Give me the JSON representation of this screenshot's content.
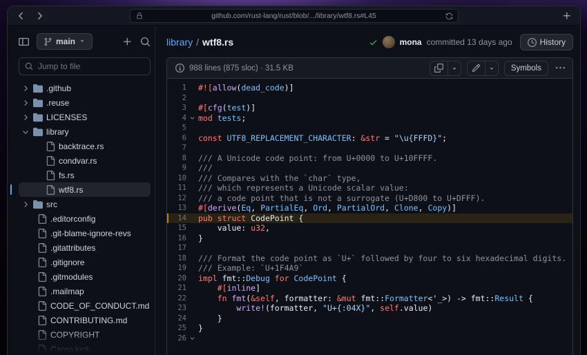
{
  "browser": {
    "url": "github.com/rust-lang/rust/blob/.../library/wtf8.rs#L45"
  },
  "sidebar": {
    "branch": "main",
    "jump_placeholder": "Jump to file",
    "tree": [
      {
        "name": ".github",
        "type": "dir",
        "expanded": false
      },
      {
        "name": ".reuse",
        "type": "dir",
        "expanded": false
      },
      {
        "name": "LICENSES",
        "type": "dir",
        "expanded": false
      },
      {
        "name": "library",
        "type": "dir",
        "expanded": true
      },
      {
        "name": "backtrace.rs",
        "type": "file",
        "depth": 1
      },
      {
        "name": "condvar.rs",
        "type": "file",
        "depth": 1
      },
      {
        "name": "fs.rs",
        "type": "file",
        "depth": 1
      },
      {
        "name": "wtf8.rs",
        "type": "file",
        "depth": 1,
        "selected": true
      },
      {
        "name": "src",
        "type": "dir",
        "expanded": false
      },
      {
        "name": ".editorconfig",
        "type": "file",
        "depth": 0
      },
      {
        "name": ".git-blame-ignore-revs",
        "type": "file",
        "depth": 0
      },
      {
        "name": ".gitattributes",
        "type": "file",
        "depth": 0
      },
      {
        "name": ".gitignore",
        "type": "file",
        "depth": 0
      },
      {
        "name": ".gitmodules",
        "type": "file",
        "depth": 0
      },
      {
        "name": ".mailmap",
        "type": "file",
        "depth": 0
      },
      {
        "name": "CODE_OF_CONDUCT.md",
        "type": "file",
        "depth": 0
      },
      {
        "name": "CONTRIBUTING.md",
        "type": "file",
        "depth": 0
      },
      {
        "name": "COPYRIGHT",
        "type": "file",
        "depth": 0
      },
      {
        "name": "Cargo.lock",
        "type": "file",
        "depth": 0
      }
    ]
  },
  "header": {
    "breadcrumb_dir": "library",
    "breadcrumb_separator": "/",
    "breadcrumb_file": "wtf8.rs",
    "author": "mona",
    "commit_meta": "committed 13 days ago",
    "history_label": "History"
  },
  "file_meta": {
    "summary": "988 lines (875 sloc) · 31.5 KB",
    "symbols_label": "Symbols"
  },
  "colors": {
    "link": "#58a6ff",
    "success": "#3fb950",
    "line_highlight_border": "#bb8009",
    "syntax": {
      "kw": "#ff7b72",
      "ty": "#79c0ff",
      "st": "#a5d6ff",
      "cm": "#8b949e",
      "fn": "#d2a8ff",
      "pl": "#e6edf3"
    }
  },
  "icons": {
    "back-icon": "chevron-left",
    "forward-icon": "chevron-right",
    "lock-icon": "padlock",
    "refresh-icon": "sync-arrows",
    "new-tab-icon": "plus",
    "sidebar-collapse-icon": "panel",
    "branch-icon": "git-branch",
    "caret-down-icon": "triangle-down",
    "add-icon": "plus",
    "search-icon": "magnifier",
    "folder-icon": "folder",
    "file-icon": "document",
    "chevron-icon": "chevron-right",
    "check-icon": "checkmark",
    "history-icon": "clock",
    "info-icon": "info-circle",
    "copy-icon": "overlapping-squares",
    "edit-icon": "pencil",
    "kebab-icon": "three-dots",
    "fold-chevron-icon": "chevron-down"
  },
  "code": {
    "highlight_line": 14,
    "fold_lines": [
      4,
      26
    ],
    "lines": [
      {
        "n": 1,
        "t": [
          [
            "kw",
            "#!["
          ],
          [
            "fn",
            "allow"
          ],
          [
            "pl",
            "("
          ],
          [
            "ty",
            "dead_code"
          ],
          [
            "pl",
            ")]"
          ]
        ]
      },
      {
        "n": 2,
        "t": []
      },
      {
        "n": 3,
        "t": [
          [
            "kw",
            "#["
          ],
          [
            "fn",
            "cfg"
          ],
          [
            "pl",
            "("
          ],
          [
            "ty",
            "test"
          ],
          [
            "pl",
            ")]"
          ]
        ]
      },
      {
        "n": 4,
        "t": [
          [
            "kw",
            "mod "
          ],
          [
            "ty",
            "tests"
          ],
          [
            "pl",
            ";"
          ]
        ]
      },
      {
        "n": 5,
        "t": []
      },
      {
        "n": 6,
        "t": [
          [
            "kw",
            "const "
          ],
          [
            "ty",
            "UTF8_REPLACEMENT_CHARACTER"
          ],
          [
            "pl",
            ": "
          ],
          [
            "kw",
            "&str"
          ],
          [
            "pl",
            " = "
          ],
          [
            "st",
            "\"\\u{FFFD}\""
          ],
          [
            "pl",
            ";"
          ]
        ]
      },
      {
        "n": 7,
        "t": []
      },
      {
        "n": 8,
        "t": [
          [
            "cm",
            "/// A Unicode code point: from U+0000 to U+10FFFF."
          ]
        ]
      },
      {
        "n": 9,
        "t": [
          [
            "cm",
            "///"
          ]
        ]
      },
      {
        "n": 10,
        "t": [
          [
            "cm",
            "/// Compares with the `char` type,"
          ]
        ]
      },
      {
        "n": 11,
        "t": [
          [
            "cm",
            "/// which represents a Unicode scalar value:"
          ]
        ]
      },
      {
        "n": 12,
        "t": [
          [
            "cm",
            "/// a code point that is not a surrogate (U+D800 to U+DFFF)."
          ]
        ]
      },
      {
        "n": 13,
        "t": [
          [
            "kw",
            "#["
          ],
          [
            "fn",
            "derive"
          ],
          [
            "pl",
            "("
          ],
          [
            "ty",
            "Eq"
          ],
          [
            "pl",
            ", "
          ],
          [
            "ty",
            "PartialEq"
          ],
          [
            "pl",
            ", "
          ],
          [
            "ty",
            "Ord"
          ],
          [
            "pl",
            ", "
          ],
          [
            "ty",
            "PartialOrd"
          ],
          [
            "pl",
            ", "
          ],
          [
            "ty",
            "Clone"
          ],
          [
            "pl",
            ", "
          ],
          [
            "ty",
            "Copy"
          ],
          [
            "pl",
            ")]"
          ]
        ]
      },
      {
        "n": 14,
        "t": [
          [
            "kw",
            "pub struct "
          ],
          [
            "pl",
            "CodePoint {"
          ]
        ]
      },
      {
        "n": 15,
        "t": [
          [
            "pl",
            "    value: "
          ],
          [
            "kw",
            "u32"
          ],
          [
            "pl",
            ","
          ]
        ]
      },
      {
        "n": 16,
        "t": [
          [
            "pl",
            "}"
          ]
        ]
      },
      {
        "n": 17,
        "t": []
      },
      {
        "n": 18,
        "t": [
          [
            "cm",
            "/// Format the code point as `U+` followed by four to six hexadecimal digits."
          ]
        ]
      },
      {
        "n": 19,
        "t": [
          [
            "cm",
            "/// Example: `U+1F4A9`"
          ]
        ]
      },
      {
        "n": 20,
        "t": [
          [
            "kw",
            "impl "
          ],
          [
            "pl",
            "fmt::"
          ],
          [
            "ty",
            "Debug"
          ],
          [
            "kw",
            " for "
          ],
          [
            "ty",
            "CodePoint"
          ],
          [
            "pl",
            " {"
          ]
        ]
      },
      {
        "n": 21,
        "t": [
          [
            "pl",
            "    "
          ],
          [
            "kw",
            "#["
          ],
          [
            "fn",
            "inline"
          ],
          [
            "pl",
            "]"
          ]
        ]
      },
      {
        "n": 22,
        "t": [
          [
            "pl",
            "    "
          ],
          [
            "kw",
            "fn "
          ],
          [
            "fn",
            "fmt"
          ],
          [
            "pl",
            "("
          ],
          [
            "kw",
            "&self"
          ],
          [
            "pl",
            ", formatter: "
          ],
          [
            "kw",
            "&mut "
          ],
          [
            "pl",
            "fmt::"
          ],
          [
            "ty",
            "Formatter"
          ],
          [
            "pl",
            "<'_>) -> fmt::"
          ],
          [
            "ty",
            "Result"
          ],
          [
            "pl",
            " {"
          ]
        ]
      },
      {
        "n": 23,
        "t": [
          [
            "pl",
            "        "
          ],
          [
            "fn",
            "write!"
          ],
          [
            "pl",
            "(formatter, "
          ],
          [
            "st",
            "\"U+{:04X}\""
          ],
          [
            "pl",
            ", "
          ],
          [
            "kw",
            "self"
          ],
          [
            "pl",
            ".value)"
          ]
        ]
      },
      {
        "n": 24,
        "t": [
          [
            "pl",
            "    }"
          ]
        ]
      },
      {
        "n": 25,
        "t": [
          [
            "pl",
            "}"
          ]
        ]
      },
      {
        "n": 26,
        "t": []
      }
    ]
  }
}
